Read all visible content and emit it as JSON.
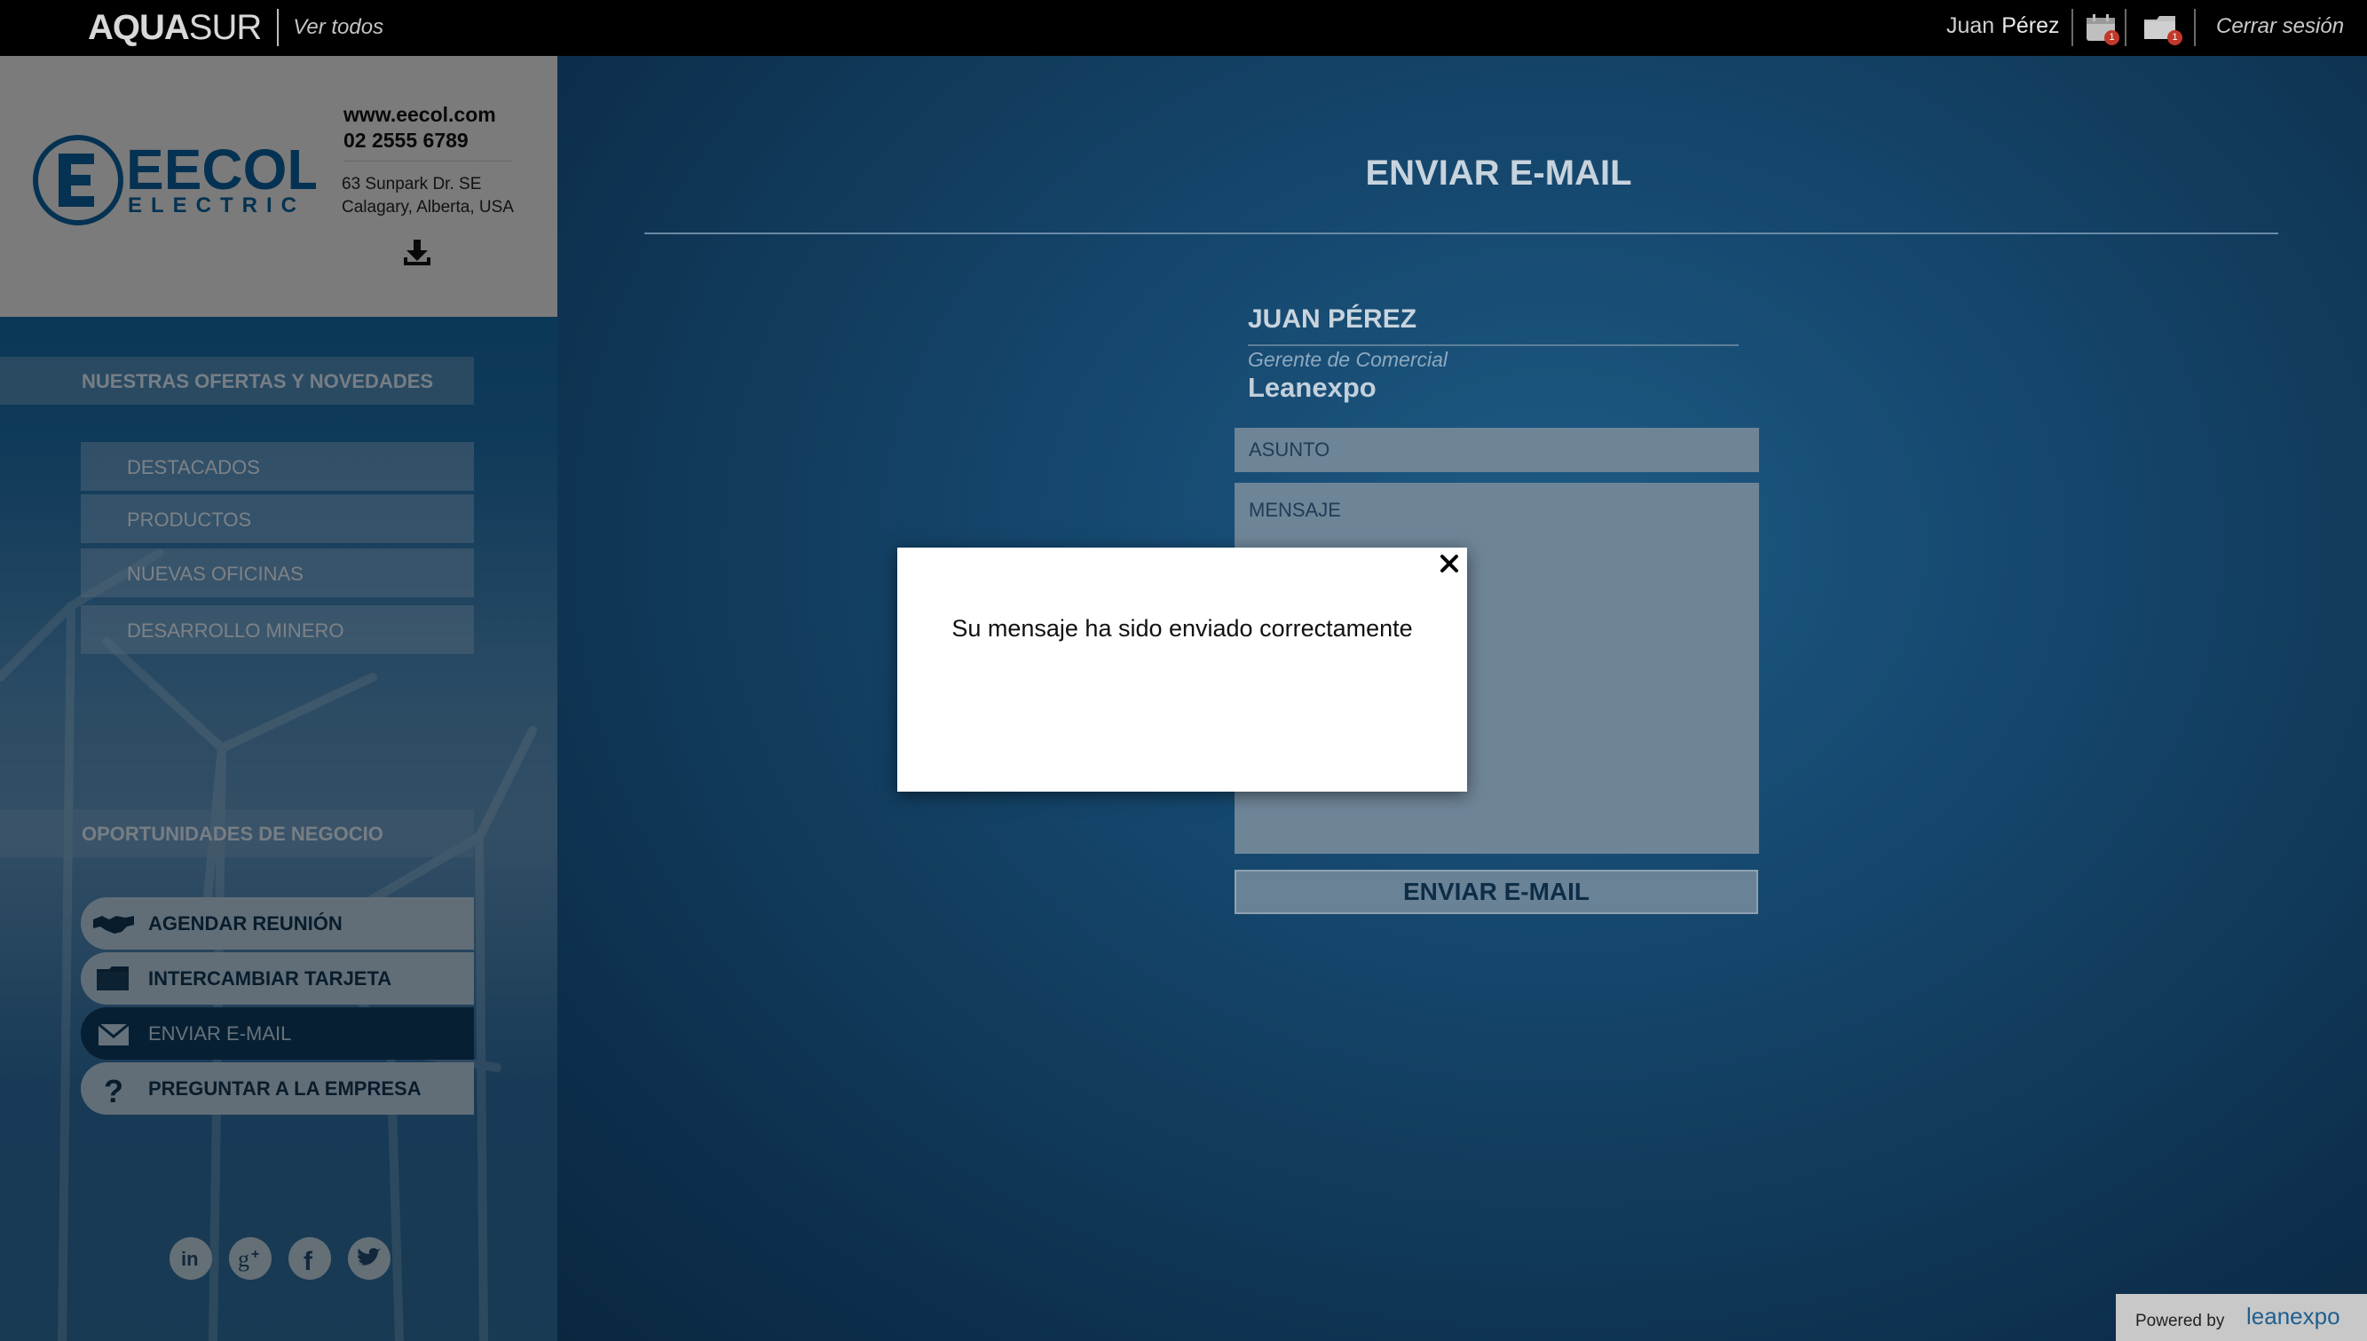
{
  "topbar": {
    "brand_bold": "AQUA",
    "brand_light": "SUR",
    "brand_link": "Ver todos",
    "user_first": "Juan",
    "user_last": "Pérez",
    "calendar_badge": "1",
    "cards_badge": "1",
    "logout": "Cerrar sesión"
  },
  "company": {
    "website": "www.eecol.com",
    "phone": "02 2555 6789",
    "address_line1": "63 Sunpark Dr. SE",
    "address_line2": "Calagary, Alberta, USA",
    "logo_word": "EECOL",
    "logo_sub": "ELECTRIC"
  },
  "sidebar": {
    "offers_heading": "NUESTRAS OFERTAS Y NOVEDADES",
    "offers": [
      "DESTACADOS",
      "PRODUCTOS",
      "NUEVAS OFICINAS",
      "DESARROLLO MINERO"
    ],
    "business_heading": "OPORTUNIDADES DE NEGOCIO",
    "actions": [
      "AGENDAR REUNIÓN",
      "INTERCAMBIAR TARJETA",
      "ENVIAR E-MAIL",
      "PREGUNTAR A LA EMPRESA"
    ],
    "social": [
      "linkedin-icon",
      "google-plus-icon",
      "facebook-icon",
      "twitter-icon"
    ]
  },
  "main": {
    "title": "ENVIAR E-MAIL",
    "contact_name": "JUAN PÉREZ",
    "contact_role": "Gerente de Comercial",
    "contact_company": "Leanexpo",
    "subject_placeholder": "ASUNTO",
    "message_placeholder": "MENSAJE",
    "send_label": "ENVIAR E-MAIL"
  },
  "footer": {
    "powered_label": "Powered by",
    "powered_logo": "leanexpo"
  },
  "modal": {
    "message": "Su mensaje ha sido enviado correctamente"
  },
  "colors": {
    "accent": "#0a5c95",
    "badge": "#c0392b",
    "topbar": "#000000"
  }
}
